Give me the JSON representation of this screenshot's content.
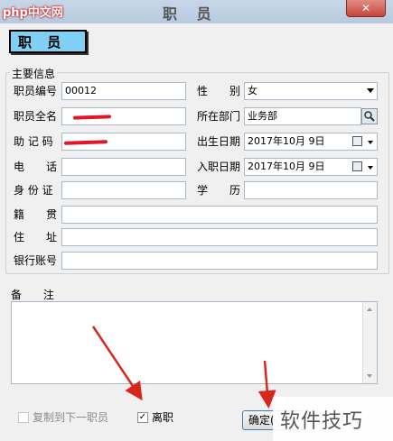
{
  "titlebar": {
    "watermark": "php中文网",
    "title": "职 员",
    "close_glyph": "✕"
  },
  "heading": {
    "label": "职 员"
  },
  "group": {
    "title": "主要信息"
  },
  "fields": {
    "staff_no": {
      "label": "职员编号",
      "value": "00012"
    },
    "full_name": {
      "label": "职员全名",
      "value": ""
    },
    "mnemonic": {
      "label": "助 记 码",
      "value": ""
    },
    "phone": {
      "label": "电　　话",
      "value": ""
    },
    "id_card": {
      "label": "身 份 证",
      "value": ""
    },
    "hometown": {
      "label": "籍　　贯",
      "value": ""
    },
    "address": {
      "label": "住　　址",
      "value": ""
    },
    "bank_account": {
      "label": "银行账号",
      "value": ""
    },
    "gender": {
      "label": "性　　别",
      "value": "女"
    },
    "department": {
      "label": "所在部门",
      "value": "业务部"
    },
    "birth_date": {
      "label": "出生日期",
      "value": "2017年10月  9日"
    },
    "hire_date": {
      "label": "入职日期",
      "value": "2017年10月  9日"
    },
    "education": {
      "label": "学　　历",
      "value": ""
    }
  },
  "memo": {
    "label": "备 注",
    "value": ""
  },
  "footer": {
    "copy_next_label": "复制到下一职员",
    "copy_next_checked": false,
    "resigned_label": "离职",
    "resigned_checked": true,
    "check_glyph": "✓",
    "ok_label": "确定("
  },
  "overlay_watermark": "软件技巧",
  "colors": {
    "heading_bg": "#7fd0f2",
    "annotation_arrow": "#d9261c",
    "redaction": "#e0162b"
  },
  "icons": {
    "department_lookup": "search-icon",
    "date_picker": "calendar-icon"
  }
}
